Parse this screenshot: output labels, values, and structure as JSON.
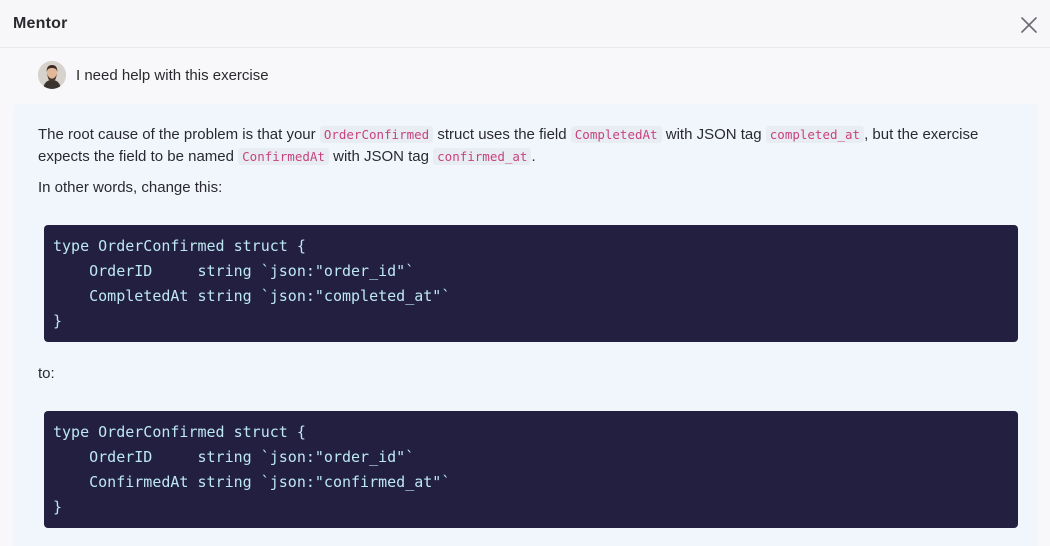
{
  "header": {
    "title": "Mentor",
    "close_icon": "close-icon"
  },
  "user": {
    "avatar_icon": "user-avatar",
    "message": "I need help with this exercise"
  },
  "reply": {
    "p1": {
      "t1": "The root cause of the problem is that your ",
      "c1": "OrderConfirmed",
      "t2": " struct uses the field ",
      "c2": "CompletedAt",
      "t3": " with JSON tag ",
      "c3": "completed_at",
      "t4": ", but the exercise expects the field to be named ",
      "c4": "ConfirmedAt",
      "t5": " with JSON tag ",
      "c5": "confirmed_at",
      "t6": "."
    },
    "p2": "In other words, change this:",
    "code1": [
      "type OrderConfirmed struct {",
      "    OrderID     string `json:\"order_id\"`",
      "    CompletedAt string `json:\"completed_at\"`",
      "}"
    ],
    "p3": "to:",
    "code2": [
      "type OrderConfirmed struct {",
      "    OrderID     string `json:\"order_id\"`",
      "    ConfirmedAt string `json:\"confirmed_at\"`",
      "}"
    ]
  },
  "colors": {
    "code_bg": "#221f40",
    "code_fg": "#bde8f2",
    "inline_code_fg": "#c7437f",
    "reply_bg": "#f1f6fd"
  }
}
